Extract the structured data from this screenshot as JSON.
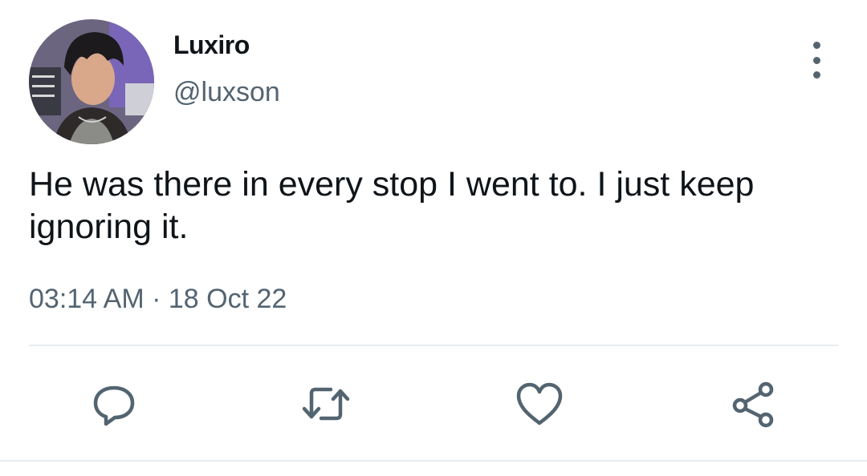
{
  "user": {
    "display_name": "Luxiro",
    "handle": "@luxson",
    "avatar_icon": "profile-photo"
  },
  "tweet": {
    "text": "He was there in every stop I went to. I just keep ignoring it."
  },
  "meta": {
    "time": "03:14 AM",
    "separator": "·",
    "date": "18 Oct 22"
  },
  "actions": {
    "icons": [
      "comment-icon",
      "retweet-icon",
      "like-icon",
      "share-icon"
    ],
    "color": "#536471"
  },
  "colors": {
    "text_primary": "#0f1419",
    "text_secondary": "#536471",
    "divider": "#e6ecf0"
  }
}
